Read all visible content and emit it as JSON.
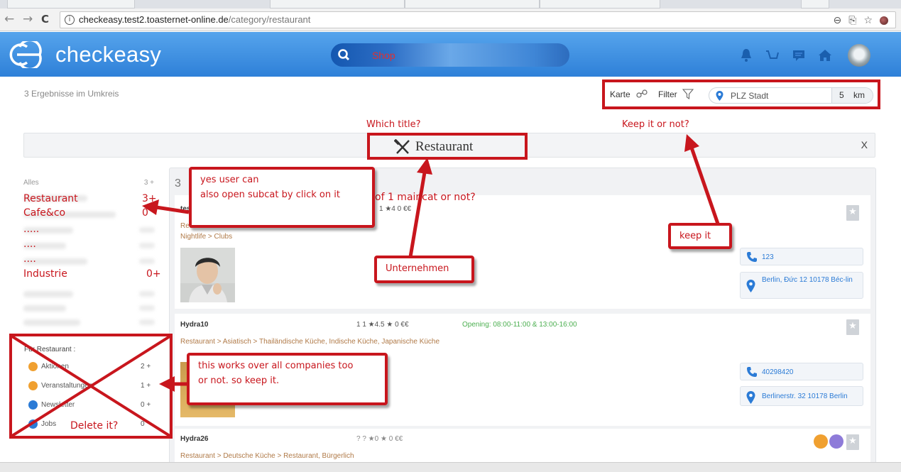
{
  "browser": {
    "url_host": "checkeasy.test2.toasternet-online.de",
    "url_path": "/category/restaurant",
    "back_glyph": "←",
    "forward_glyph": "→",
    "reload_glyph": "C",
    "info_glyph": "i",
    "tool_zoom": "⊖",
    "tool_translate": "⎘",
    "tool_star": "☆"
  },
  "header": {
    "logo_text": "checkeasy",
    "search_text": "Shop",
    "brand_color": "#3a8ee0",
    "icons": [
      "bell-icon",
      "cart-icon",
      "chat-icon",
      "home-icon",
      "user-avatar"
    ]
  },
  "toolbar": {
    "results_count": "3 Ergebnisse im Umkreis",
    "karte_label": "Karte",
    "filter_label": "Filter",
    "plz_placeholder": "PLZ Stadt",
    "radius_value": "5",
    "radius_unit": "km"
  },
  "category": {
    "title": "Restaurant",
    "close_label": "X"
  },
  "sidebar": {
    "alles_label": "Alles",
    "alles_count": "3 +",
    "items": [
      {
        "label": "Restaurant",
        "count": "3+"
      },
      {
        "label": "Cafe&co",
        "count": "0"
      },
      {
        "label": "....."
      },
      {
        "label": "...."
      },
      {
        "label": "...."
      },
      {
        "label": "Industrie",
        "count": "0+"
      }
    ],
    "fuer_label": "Für Restaurant :",
    "features": [
      {
        "label": "Aktionen",
        "count": "2 +",
        "icon": "calendar-icon",
        "color": "#f0a030"
      },
      {
        "label": "Veranstaltungen",
        "count": "1 +",
        "icon": "calendar-icon",
        "color": "#f0a030"
      },
      {
        "label": "Newsletter",
        "count": "0 +",
        "icon": "newsletter-icon",
        "color": "#2b7bd6"
      },
      {
        "label": "Jobs",
        "count": "0",
        "icon": "jobs-icon",
        "color": "#2b7bd6"
      }
    ]
  },
  "list": {
    "head_digit": "3",
    "cards": [
      {
        "name": "tes",
        "rating": "1   ★4  0   €€",
        "crumb1": "Restaurant  >  Deutsche Küche",
        "crumb2": "Nightlife  >  Clubs",
        "phone": "123",
        "address": "Berlin, Đức 12 10178 Béc-lin"
      },
      {
        "name": "Hydra10",
        "rating": "1   1   ★4.5 ★ 0    €€",
        "opening": "Opening: 08:00-11:00 & 13:00-16:00",
        "crumb1": "Restaurant  >  Asiatisch  >  Thailändische Küche,  Indische Küche,  Japanische Küche",
        "phone": "40298420",
        "address": "Berlinerstr. 32 10178 Berlin"
      },
      {
        "name": "Hydra26",
        "rating": "?   ?    ★0 ★ 0    €€",
        "crumb1": "Restaurant  >  Deutsche Küche  >  Restaurant,  Bürgerlich"
      }
    ]
  },
  "annotations": {
    "which_title": "Which title?",
    "keep_it_or_not": "Keep it or not?",
    "yes_user_can_1": "yes user can",
    "yes_user_can_2": "also open subcat by click on it",
    "mancat": "of 1 maincat or not?",
    "keep_it": "keep it",
    "unternehmen": "Unternehmen",
    "works_over_1": "this works over all companies too",
    "works_over_2": "or not. so keep it.",
    "delete_it": "Delete it?",
    "accent_color": "#c8161d"
  }
}
